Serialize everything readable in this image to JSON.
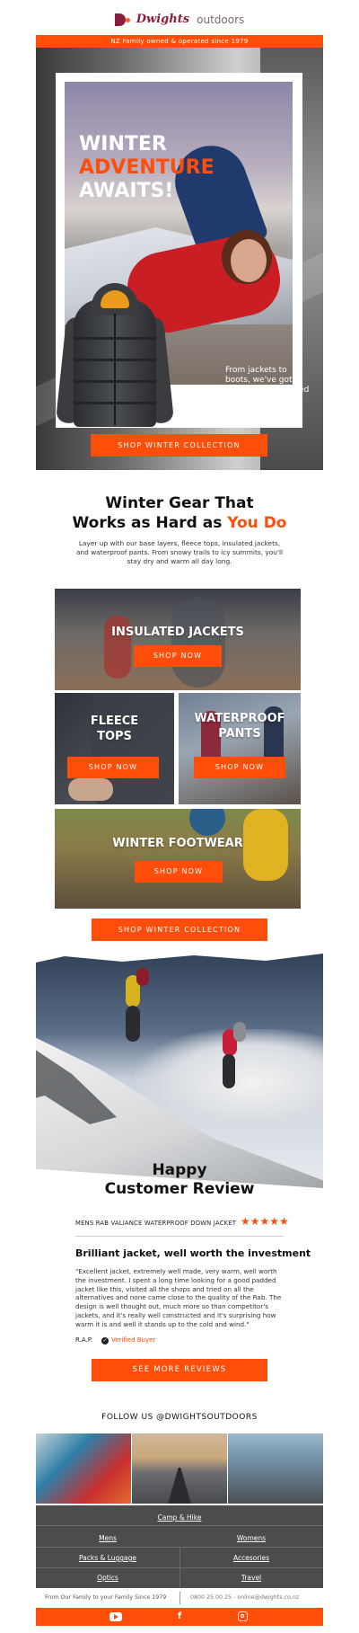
{
  "header": {
    "brand_name": "Dwights",
    "brand_suffix": "outdoors",
    "tagline": "NZ Family owned & operated since 1979"
  },
  "hero": {
    "title_line1": "WINTER",
    "title_line2": "ADVENTURE",
    "title_line3": "AWAITS!",
    "blurb": "From jackets to boots, we've got everything you need to brave the cold with confidence!",
    "cta": "SHOP WINTER COLLECTION"
  },
  "gear": {
    "title_line1": "Winter Gear That",
    "title_line2_prefix": "Works as Hard as ",
    "title_line2_accent": "You Do",
    "copy": "Layer up with our base layers, fleece tops, insulated jackets, and waterproof pants. From snowy trails to icy summits, you'll stay dry and warm all day long.",
    "tiles": [
      {
        "label_line1": "INSULATED JACKETS",
        "label_line2": "",
        "cta": "SHOP NOW"
      },
      {
        "label_line1": "FLEECE",
        "label_line2": "TOPS",
        "cta": "SHOP NOW"
      },
      {
        "label_line1": "WATERPROOF",
        "label_line2": "PANTS",
        "cta": "SHOP NOW"
      },
      {
        "label_line1": "WINTER FOOTWEAR",
        "label_line2": "",
        "cta": "SHOP NOW"
      }
    ],
    "cta": "SHOP WINTER COLLECTION"
  },
  "review": {
    "title_line1": "Happy",
    "title_line2": "Customer Review",
    "product": "MENS RAB VALIANCE WATERPROOF DOWN JACKET",
    "stars": "★★★★★",
    "rating": 5,
    "headline": "Brilliant jacket, well worth the investment",
    "body": "\"Excellent jacket, extremely well made, very warm, well worth the investment. I spent a long time looking for a good padded jacket like this, visited all the shops and tried on all the alternatives and none came close to the quality of the Rab. The design is well thought out, much more so than competitor's jackets, and it's really well constructed and it's surprising how warm it is and well it stands up to the cold and wind.\"",
    "author": "R.A.P.",
    "verified": "Verified Buyer",
    "cta": "SEE MORE REVIEWS"
  },
  "social_section": {
    "follow": "FOLLOW US @DWIGHTSOUTDOORS"
  },
  "footer": {
    "nav": {
      "camp": "Camp & Hike",
      "mens": "Mens",
      "womens": "Womens",
      "packs": "Packs & Luggage",
      "accessories": "Accesories",
      "optics": "Optics",
      "travel": "Travel"
    },
    "left_text": "From Our Family to your Family Since 1979",
    "right_text": "0800 25 00 25  -  online@dwights.co.nz",
    "social_icons": [
      "youtube-icon",
      "facebook-icon",
      "instagram-icon"
    ],
    "facebook_glyph": "f"
  },
  "colors": {
    "accent": "#ff4e0a",
    "brand": "#8a1e3b",
    "footer_bg": "#4c4c4c"
  }
}
